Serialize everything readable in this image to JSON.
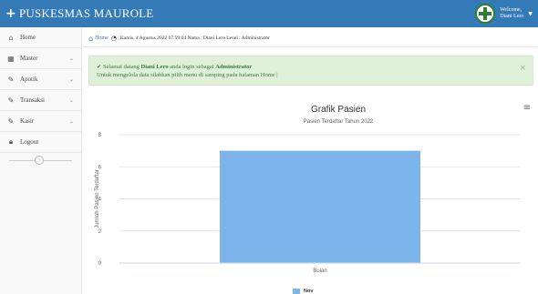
{
  "header": {
    "brand": "PUSKESMAS MAUROLE",
    "brand_icon": "plus-icon",
    "user_line1": "Welcome,",
    "user_line2": "Diani Lero",
    "logo_icon": "health-cross-logo"
  },
  "sidebar": {
    "items": [
      {
        "label": "Home",
        "icon": "home-icon",
        "has_caret": false
      },
      {
        "label": "Master",
        "icon": "table-icon",
        "has_caret": true
      },
      {
        "label": "Apotik",
        "icon": "edit-icon",
        "has_caret": true
      },
      {
        "label": "Transaksi",
        "icon": "edit-icon",
        "has_caret": true
      },
      {
        "label": "Kasir",
        "icon": "edit-icon",
        "has_caret": true
      },
      {
        "label": "Logout",
        "icon": "lock-icon",
        "has_caret": false
      }
    ]
  },
  "breadcrumb": {
    "home": "Home",
    "info": "Kamis, 4 Agustus 2022 07:59:04 Nama : Diani Lero Level : Administrator"
  },
  "alert": {
    "pre": "Selamat datang",
    "name": "Diani Lero",
    "mid": "anda login sebagai",
    "role": "Administrator",
    "line2": "Untuk mengelola data silahkan pilih menu di samping pada halaman Home |"
  },
  "colors": {
    "navbar": "#337ab7",
    "bar": "#7cb5ec",
    "alert_bg": "#dff0d8",
    "alert_text": "#3c763d"
  },
  "chart_data": {
    "type": "bar",
    "title": "Grafik Pasien",
    "subtitle": "Pasien Terdaftar Tahun 2022",
    "xlabel": "",
    "ylabel": "Jumlah Pasien Terdaftar",
    "categories": [
      "Bulan"
    ],
    "series": [
      {
        "name": "Nov",
        "values": [
          7
        ]
      }
    ],
    "y_ticks": [
      "0",
      "2",
      "4",
      "6",
      "8"
    ],
    "ylim": [
      0,
      8
    ],
    "grid": true,
    "legend": "bottom-center"
  }
}
